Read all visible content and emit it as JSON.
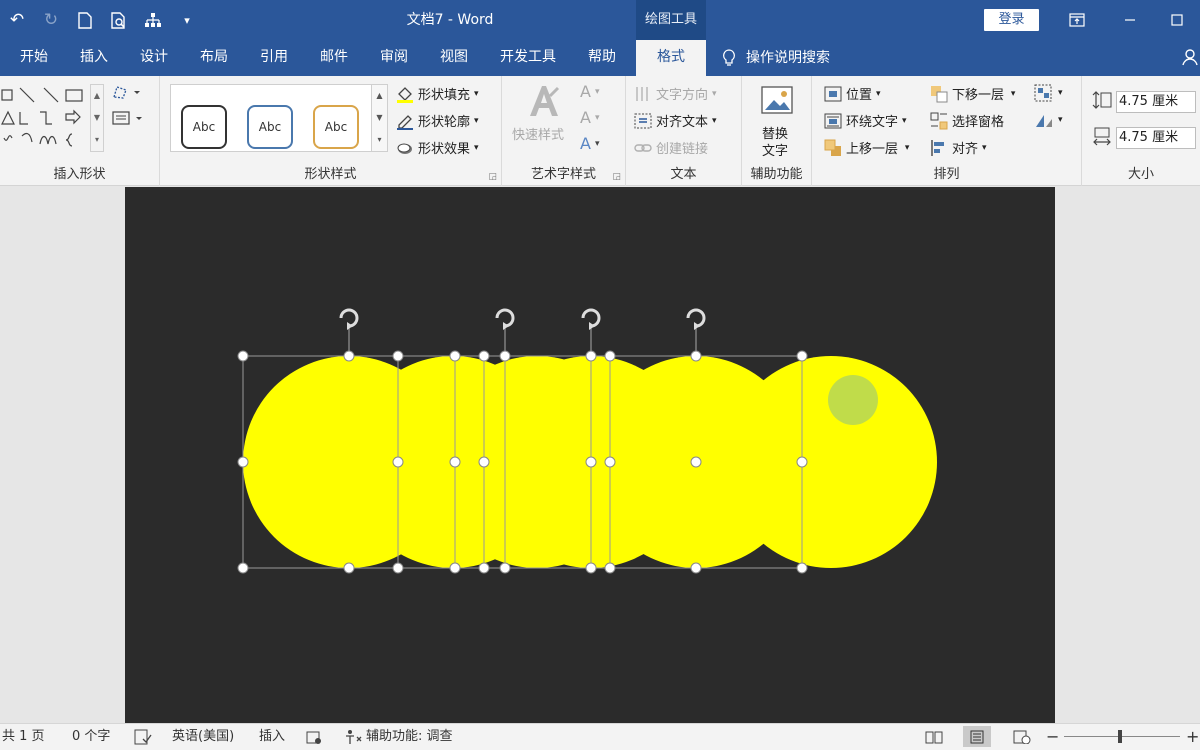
{
  "titlebar": {
    "doc_title": "文档7  -  Word",
    "context_tab": "绘图工具",
    "login": "登录"
  },
  "tabs": [
    "开始",
    "插入",
    "设计",
    "布局",
    "引用",
    "邮件",
    "审阅",
    "视图",
    "开发工具",
    "帮助",
    "格式"
  ],
  "active_tab": "格式",
  "tellme": "操作说明搜索",
  "ribbon": {
    "insert_shapes": {
      "label": "插入形状"
    },
    "shape_styles": {
      "label": "形状样式",
      "presets": [
        "Abc",
        "Abc",
        "Abc"
      ],
      "fill": "形状填充",
      "outline": "形状轮廓",
      "effects": "形状效果"
    },
    "wordart": {
      "label": "艺术字样式",
      "quick_styles": "快速样式"
    },
    "text": {
      "label": "文本",
      "direction": "文字方向",
      "align": "对齐文本",
      "link": "创建链接"
    },
    "accessibility": {
      "label": "辅助功能",
      "alt_text_1": "替换",
      "alt_text_2": "文字"
    },
    "arrange": {
      "label": "排列",
      "position": "位置",
      "wrap": "环绕文字",
      "forward": "上移一层",
      "backward": "下移一层",
      "pane": "选择窗格",
      "align": "对齐"
    },
    "size": {
      "label": "大小",
      "height": "4.75 厘米",
      "width": "4.75 厘米"
    }
  },
  "statusbar": {
    "pages": "共 1 页",
    "words": "0 个字",
    "language": "英语(美国)",
    "mode": "插入",
    "accessibility": "辅助功能: 调查"
  },
  "colors": {
    "title_blue": "#2b579a",
    "canvas": "#2b2b2b",
    "circle_yellow": "#ffff00",
    "small_circle": "#c0dc4a"
  }
}
